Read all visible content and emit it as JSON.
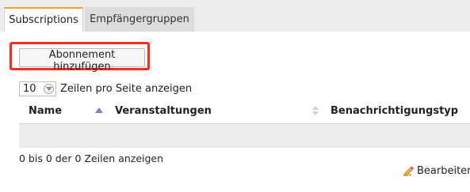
{
  "tabs": [
    {
      "label": "Subscriptions",
      "active": true
    },
    {
      "label": "Empfängergruppen",
      "active": false
    }
  ],
  "toolbar": {
    "add_label": "Abonnement hinzufügen"
  },
  "paging": {
    "page_size": "10",
    "page_size_label": "Zeilen pro Seite anzeigen"
  },
  "table": {
    "columns": [
      "Name",
      "Veranstaltungen",
      "Benachrichtigungstyp"
    ],
    "rows": [],
    "info": "0 bis 0 der 0 Zeilen anzeigen"
  },
  "actions": {
    "edit_label": "Bearbeiten"
  },
  "colors": {
    "accent_tab": "#f0a030",
    "highlight": "#ff2a1a",
    "sort_active": "#7a7fc8"
  }
}
